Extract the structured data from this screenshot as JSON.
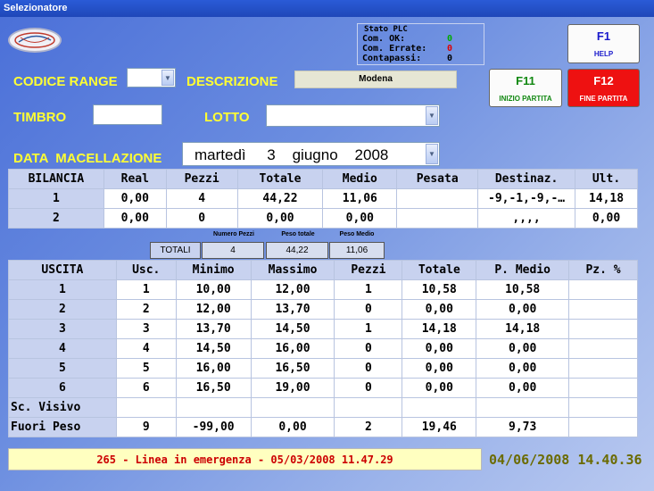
{
  "window": {
    "title": "Selezionatore"
  },
  "plc": {
    "title": "Stato PLC",
    "rows": [
      {
        "label": "Com. OK:",
        "value": "0",
        "color": "#00aa00"
      },
      {
        "label": "Com. Errate:",
        "value": "0",
        "color": "#dd0000"
      },
      {
        "label": "Contapassi:",
        "value": "0",
        "color": "#000000"
      }
    ]
  },
  "buttons": {
    "f1": {
      "key": "F1",
      "label": "HELP"
    },
    "f11": {
      "key": "F11",
      "label": "INIZIO PARTITA"
    },
    "f12": {
      "key": "F12",
      "label": "FINE PARTITA"
    }
  },
  "form": {
    "codice_range_label": "CODICE RANGE",
    "codice_range_value": "",
    "descrizione_label": "DESCRIZIONE",
    "descrizione_value": "Modena",
    "timbro_label": "TIMBRO",
    "timbro_value": "",
    "lotto_label": "LOTTO",
    "lotto_value": "",
    "data_label": "DATA  MACELLAZIONE",
    "data_value": "martedì     3    giugno    2008"
  },
  "bilancia": {
    "headers": [
      "BILANCIA",
      "Real",
      "Pezzi",
      "Totale",
      "Medio",
      "Pesata",
      "Destinaz.",
      "Ult."
    ],
    "rows": [
      [
        "1",
        "0,00",
        "4",
        "44,22",
        "11,06",
        "",
        "-9,-1,-9,-…",
        "14,18"
      ],
      [
        "2",
        "0,00",
        "0",
        "0,00",
        "0,00",
        "",
        ",,,,",
        "0,00"
      ]
    ]
  },
  "totali": {
    "label": "TOTALI",
    "captions": [
      "Numero Pezzi",
      "Peso totale",
      "Peso Medio"
    ],
    "values": [
      "4",
      "44,22",
      "11,06"
    ]
  },
  "uscita": {
    "headers": [
      "USCITA",
      "Usc.",
      "Minimo",
      "Massimo",
      "Pezzi",
      "Totale",
      "P. Medio",
      "Pz. %"
    ],
    "rows": [
      [
        "1",
        "1",
        "10,00",
        "12,00",
        "1",
        "10,58",
        "10,58",
        ""
      ],
      [
        "2",
        "2",
        "12,00",
        "13,70",
        "0",
        "0,00",
        "0,00",
        ""
      ],
      [
        "3",
        "3",
        "13,70",
        "14,50",
        "1",
        "14,18",
        "14,18",
        ""
      ],
      [
        "4",
        "4",
        "14,50",
        "16,00",
        "0",
        "0,00",
        "0,00",
        ""
      ],
      [
        "5",
        "5",
        "16,00",
        "16,50",
        "0",
        "0,00",
        "0,00",
        ""
      ],
      [
        "6",
        "6",
        "16,50",
        "19,00",
        "0",
        "0,00",
        "0,00",
        ""
      ],
      [
        "Sc. Visivo",
        "",
        "",
        "",
        "",
        "",
        "",
        ""
      ],
      [
        "Fuori Peso",
        "9",
        "-99,00",
        "0,00",
        "2",
        "19,46",
        "9,73",
        ""
      ]
    ]
  },
  "status": {
    "message": "265 - Linea in emergenza - 05/03/2008 11.47.29",
    "clock": "04/06/2008 14.40.36"
  }
}
